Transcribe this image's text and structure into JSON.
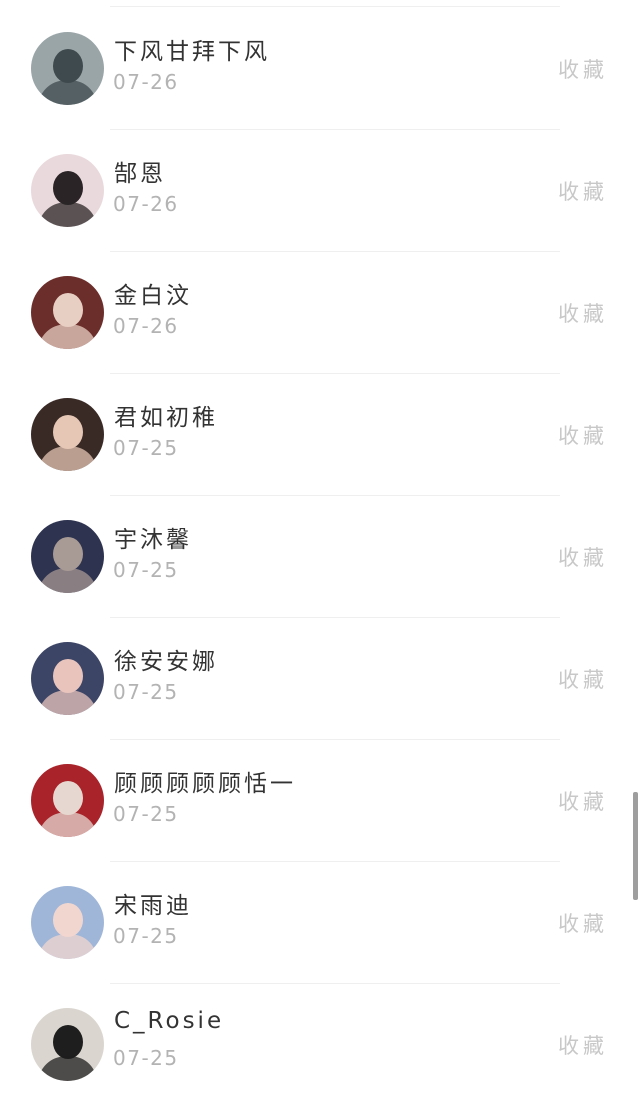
{
  "list": {
    "items": [
      {
        "name": "下风甘拜下风",
        "date": "07-26",
        "action": "收藏",
        "avatar_colors": [
          "#9aa5a8",
          "#3e4a4e"
        ]
      },
      {
        "name": "郜恩",
        "date": "07-26",
        "action": "收藏",
        "avatar_colors": [
          "#e9d9dc",
          "#2a2426"
        ]
      },
      {
        "name": "金白汶",
        "date": "07-26",
        "action": "收藏",
        "avatar_colors": [
          "#6b2e2a",
          "#e8cfc3"
        ]
      },
      {
        "name": "君如初稚",
        "date": "07-25",
        "action": "收藏",
        "avatar_colors": [
          "#3a2a26",
          "#e6c7b6"
        ]
      },
      {
        "name": "宇沐馨",
        "date": "07-25",
        "action": "收藏",
        "avatar_colors": [
          "#2e3350",
          "#a89a94"
        ]
      },
      {
        "name": "徐安安娜",
        "date": "07-25",
        "action": "收藏",
        "avatar_colors": [
          "#3d4566",
          "#e8c4bd"
        ]
      },
      {
        "name": "顾顾顾顾顾恬一",
        "date": "07-25",
        "action": "收藏",
        "avatar_colors": [
          "#a8232a",
          "#e6d8d0"
        ]
      },
      {
        "name": "宋雨迪",
        "date": "07-25",
        "action": "收藏",
        "avatar_colors": [
          "#9fb6d8",
          "#f1d6cf"
        ]
      },
      {
        "name": "C_Rosie",
        "date": "07-25",
        "action": "收藏",
        "avatar_colors": [
          "#dad6cf",
          "#1e1e1e"
        ]
      }
    ]
  }
}
